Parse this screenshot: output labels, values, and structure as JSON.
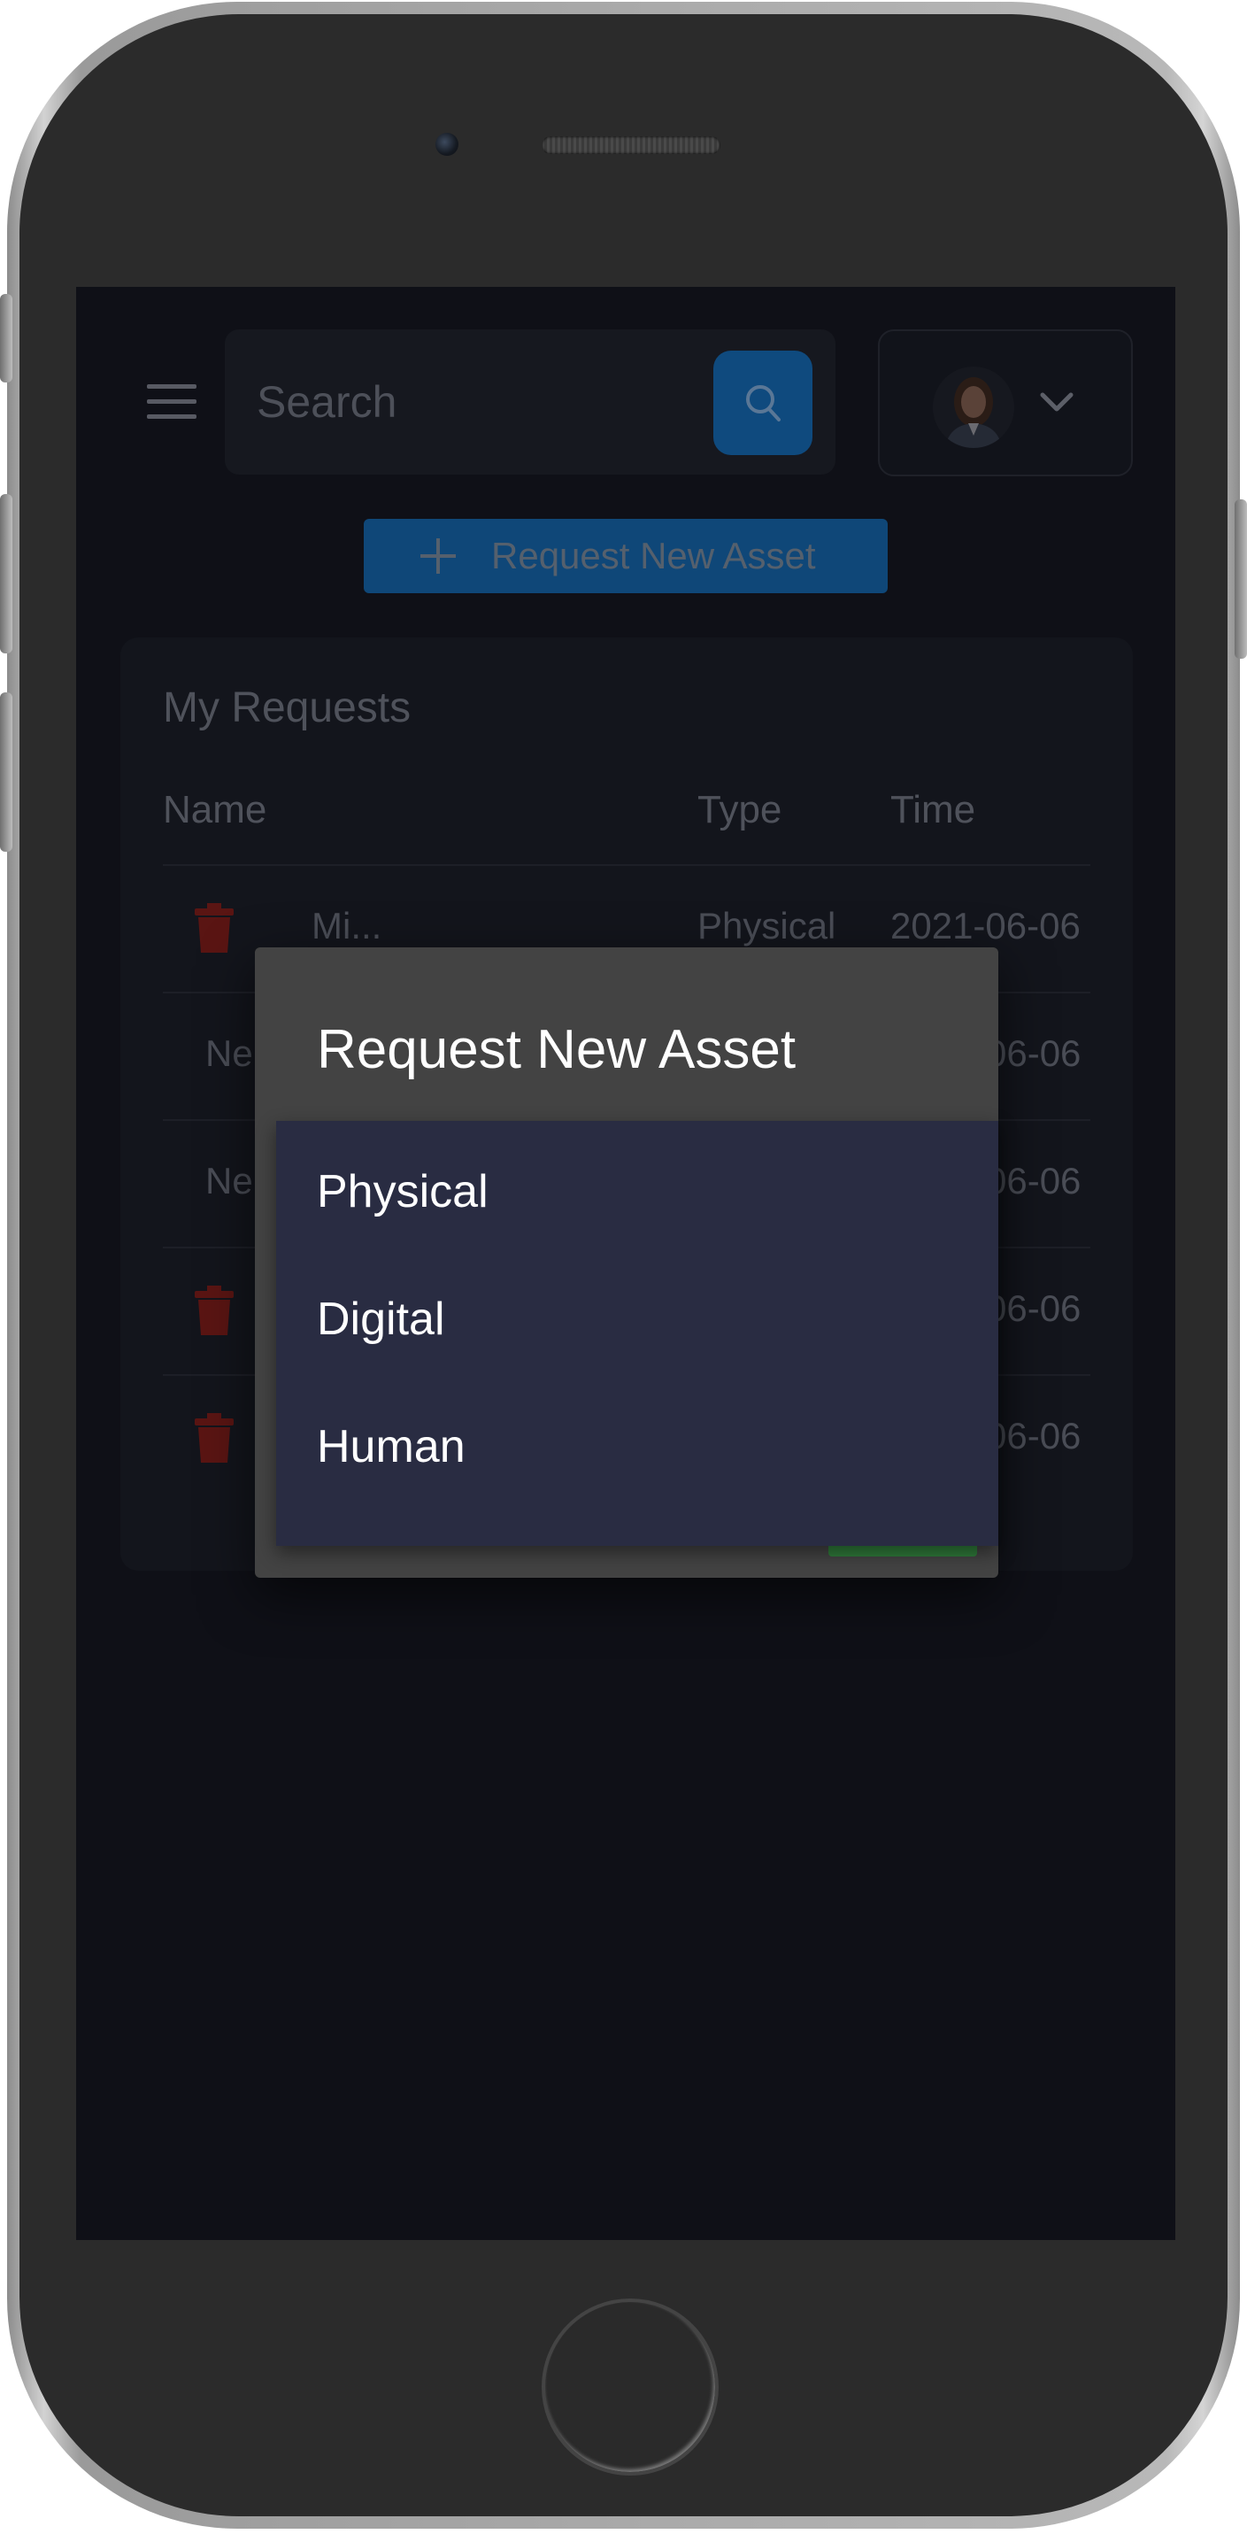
{
  "search": {
    "placeholder": "Search"
  },
  "toolbar": {
    "request_label": "Request New Asset"
  },
  "requests": {
    "title": "My Requests",
    "columns": [
      "Name",
      "Type",
      "Time"
    ],
    "rows": [
      {
        "name": "Mi...",
        "type": "Physical",
        "time": "2021-06-06",
        "deletable": true
      },
      {
        "name": "Ne",
        "type": "",
        "time": "06-06",
        "deletable": false
      },
      {
        "name": "Ne",
        "type": "",
        "time": "06-06",
        "deletable": false
      },
      {
        "name": "",
        "type": "",
        "time": "06-06",
        "deletable": true
      },
      {
        "name": "",
        "type": "",
        "time": "06-06",
        "deletable": true
      }
    ]
  },
  "modal": {
    "title": "Request New Asset",
    "options": [
      "Physical",
      "Digital",
      "Human"
    ]
  },
  "colors": {
    "accent": "#1c75d2",
    "delete": "#c0221f",
    "dropdown_bg": "#292c42",
    "modal_bg": "#434343",
    "confirm": "#43a047"
  },
  "icons": {
    "menu": "hamburger-icon",
    "search": "search-icon",
    "user": "avatar",
    "chevron": "chevron-down-icon",
    "add": "plus-icon",
    "delete": "trash-icon"
  }
}
